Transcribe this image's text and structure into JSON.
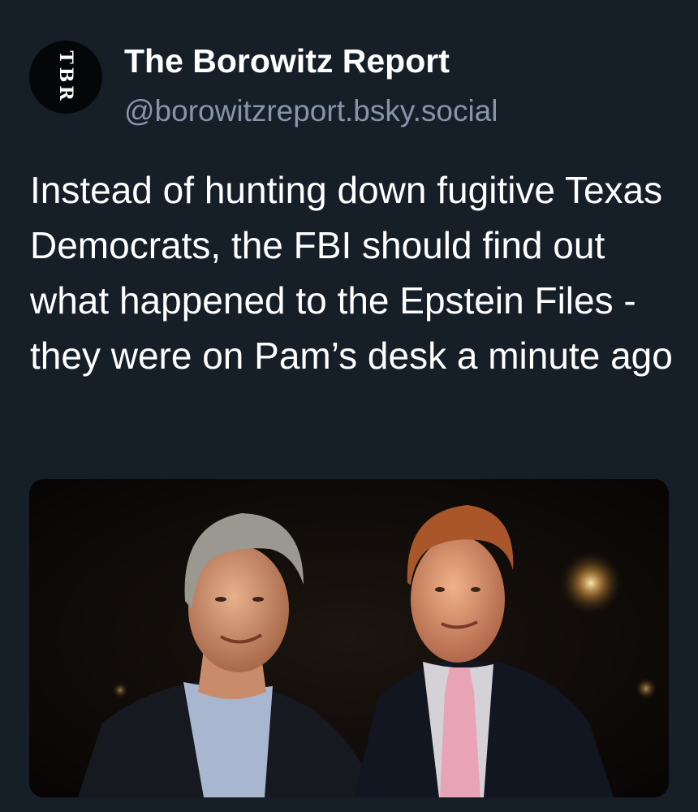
{
  "post": {
    "author": {
      "avatar_text": "TBR",
      "name": "The Borowitz Report",
      "handle": "@borowitzreport.bsky.social"
    },
    "text": "Instead of hunting down fugitive Texas Democrats, the FBI should find out what happened to the Epstein Files - they were on Pam’s desk a minute ago",
    "media": {
      "type": "photo"
    }
  },
  "colors": {
    "background": "#161e28",
    "name": "#ffffff",
    "handle": "#8795a8",
    "body_text": "#ffffff"
  }
}
